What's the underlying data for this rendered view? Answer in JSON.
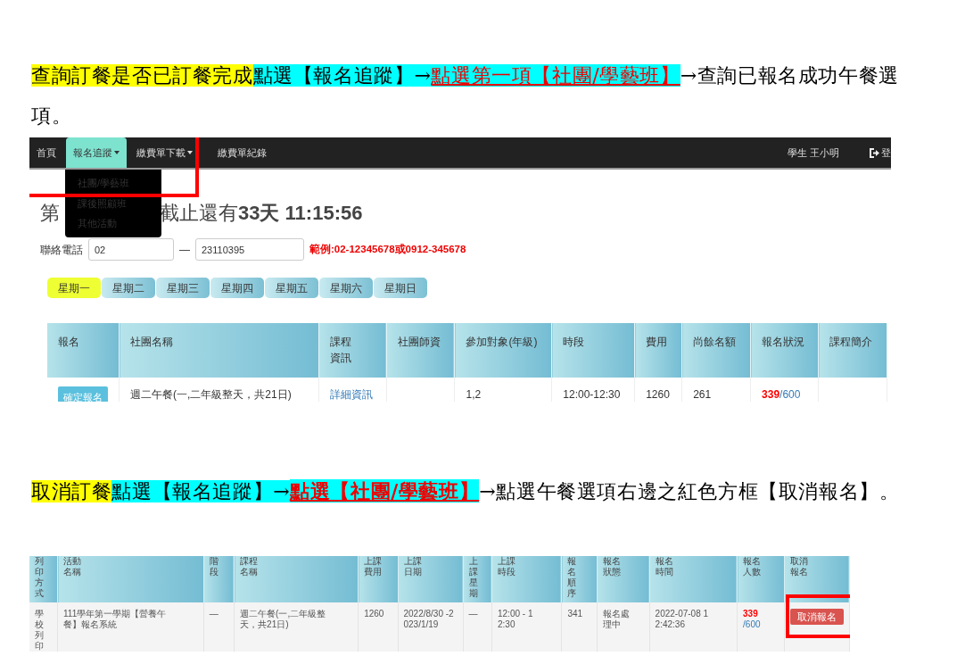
{
  "steps": [
    {
      "segments": [
        {
          "text": "查詢訂餐是否已訂餐完成",
          "color": "#ffff00",
          "kind": "plain"
        },
        {
          "text": "點選【報名追蹤】→",
          "color": "#00ffff",
          "kind": "plain"
        },
        {
          "text": "點選第一項【社團/學藝班】",
          "color": "#00ffff",
          "kind": "underlined"
        },
        {
          "text": "→查詢已報名成功午餐選項。",
          "kind": "plain"
        }
      ],
      "screenshot": {
        "kind": "signup",
        "navbar": {
          "items": [
            {
              "label": "首頁",
              "dropdown": false,
              "selected": false
            },
            {
              "label": "報名追蹤",
              "dropdown": true,
              "selected": true
            },
            {
              "label": "繳費單下載",
              "dropdown": true,
              "selected": false
            },
            {
              "label": "繳費單紀錄",
              "dropdown": false,
              "selected": false
            }
          ],
          "user": "學生 王小明",
          "logout": "登"
        },
        "menu": [
          "社團/學藝班",
          "課後照顧班",
          "其他活動"
        ],
        "heading": {
          "before": "第",
          "after": "截止還有**33天 11:15:56**"
        },
        "phone": {
          "label": "聯絡電話",
          "area": "02",
          "separator": "—",
          "number": "23110395",
          "hint": "範例:02-12345678或0912-345678"
        },
        "days": [
          {
            "label": "星期一",
            "selected": true
          },
          {
            "label": "星期二",
            "selected": false
          },
          {
            "label": "星期三",
            "selected": false
          },
          {
            "label": "星期四",
            "selected": false
          },
          {
            "label": "星期五",
            "selected": false
          },
          {
            "label": "星期六",
            "selected": false
          },
          {
            "label": "星期日",
            "selected": false
          }
        ],
        "table": {
          "columns": [
            "報名",
            "社團名稱",
            "課程資訊",
            "社團師資",
            "參加對象(年級)",
            "時段",
            "費用",
            "尚餘名額",
            "報名狀況",
            "課程簡介"
          ],
          "rows": [
            [
              {
                "kind": "button",
                "text": "確定報名"
              },
              {
                "kind": "text",
                "text": "週二午餐(一,二年級整天，共21日)"
              },
              {
                "kind": "link",
                "text": "詳細資訊"
              },
              {
                "kind": "empty"
              },
              {
                "kind": "text",
                "text": "1,2"
              },
              {
                "kind": "text",
                "text": "12:00-12:30"
              },
              {
                "kind": "text",
                "text": "1260"
              },
              {
                "kind": "text",
                "text": "261"
              },
              {
                "kind": "quota",
                "taken": "339",
                "total": "/600"
              },
              {
                "kind": "empty"
              }
            ]
          ]
        }
      }
    },
    {
      "segments": [
        {
          "text": "取消訂餐",
          "color": "#ffff00",
          "kind": "plain"
        },
        {
          "text": "點選【報名追蹤】→",
          "color": "#00ffff",
          "kind": "plain"
        },
        {
          "text": "點選【社團/學藝班】",
          "color": "#00ffff",
          "kind": "underlined-bold"
        },
        {
          "text": "→點選午餐選項右邊之紅色方框【取消報名】。",
          "kind": "plain"
        }
      ],
      "screenshot": {
        "kind": "records",
        "table": {
          "columns": [
            "列印方式",
            "活動名稱",
            "階段",
            "課程名稱",
            "上課費用",
            "上課日期",
            "上課星期",
            "上課時段",
            "報名順序",
            "報名狀態",
            "報名時間",
            "報名人數",
            "取消報名"
          ],
          "rows": [
            [
              {
                "kind": "text",
                "text": "學校列印"
              },
              {
                "kind": "text",
                "text": "111學年第一學期【營養午餐】報名系統"
              },
              {
                "kind": "text",
                "text": "—"
              },
              {
                "kind": "text",
                "text": "週二午餐(一,二年級整天，共21日)"
              },
              {
                "kind": "text",
                "text": "1260"
              },
              {
                "kind": "text",
                "text": "2022/8/30 -2023/1/19"
              },
              {
                "kind": "text",
                "text": "—"
              },
              {
                "kind": "text",
                "text": "12:00 - 12:30"
              },
              {
                "kind": "text",
                "text": "341"
              },
              {
                "kind": "text",
                "text": "報名處理中"
              },
              {
                "kind": "text",
                "text": "2022-07-08 12:42:36"
              },
              {
                "kind": "quota",
                "taken": "339",
                "total": "/600"
              },
              {
                "kind": "cancel",
                "text": "取消報名"
              }
            ]
          ]
        }
      }
    }
  ]
}
